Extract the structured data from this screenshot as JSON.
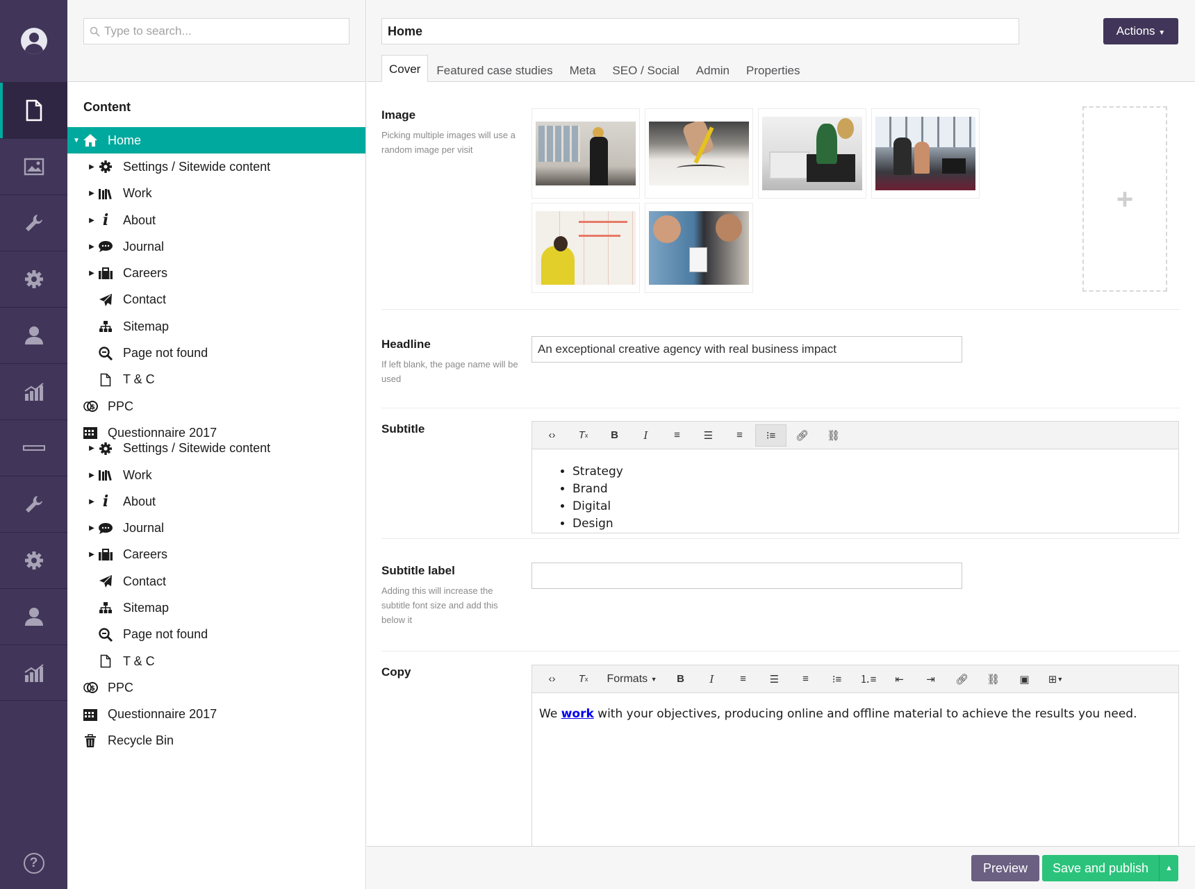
{
  "colors": {
    "rail": "#413659",
    "accent": "#00a99d",
    "save": "#2bc37c",
    "preview": "#6b6081"
  },
  "rail": {
    "sections": [
      "document-icon",
      "picture-icon",
      "wrench-icon",
      "gear-icon",
      "user-icon",
      "chart-icon",
      "ruler-icon",
      "wrench-icon",
      "gear-icon",
      "user-icon",
      "chart-icon"
    ],
    "help_symbol": "?"
  },
  "tree": {
    "search_placeholder": "Type to search...",
    "heading": "Content",
    "home": "Home",
    "nodes": [
      {
        "label": "Settings / Sitewide content",
        "icon": "gear-icon"
      },
      {
        "label": "Work",
        "icon": "books-icon"
      },
      {
        "label": "About",
        "icon": "info-icon"
      },
      {
        "label": "Journal",
        "icon": "chat-icon"
      },
      {
        "label": "Careers",
        "icon": "briefcase-icon"
      },
      {
        "label": "Contact",
        "icon": "paper-plane-icon"
      },
      {
        "label": "Sitemap",
        "icon": "sitemap-icon"
      },
      {
        "label": "Page not found",
        "icon": "search-icon"
      },
      {
        "label": "T & C",
        "icon": "file-icon"
      }
    ],
    "root_nodes": [
      {
        "label": "PPC",
        "icon": "money-icon"
      },
      {
        "label": "Questionnaire 2017",
        "icon": "calendar-icon"
      },
      {
        "label": "Recycle Bin",
        "icon": "trash-icon"
      }
    ]
  },
  "editor": {
    "page_name": "Home",
    "actions_label": "Actions",
    "tabs": [
      "Cover",
      "Featured case studies",
      "Meta",
      "SEO / Social",
      "Admin",
      "Properties"
    ],
    "image": {
      "label": "Image",
      "description": "Picking multiple images will use a random image per visit",
      "add_symbol": "+"
    },
    "headline": {
      "label": "Headline",
      "description": "If left blank, the page name will be used",
      "value": "An exceptional creative agency with real business impact"
    },
    "subtitle": {
      "label": "Subtitle",
      "items": [
        "Strategy",
        "Brand",
        "Digital",
        "Design"
      ]
    },
    "subtitle_label": {
      "label": "Subtitle label",
      "description": "Adding this will increase the subtitle font size and add this below it",
      "value": ""
    },
    "copy": {
      "label": "Copy",
      "formats_label": "Formats",
      "text_before": "We ",
      "link_text": "work",
      "text_after": " with your objectives, producing online and offline material to achieve the results you need."
    }
  },
  "footer": {
    "preview_label": "Preview",
    "save_label": "Save and publish"
  }
}
